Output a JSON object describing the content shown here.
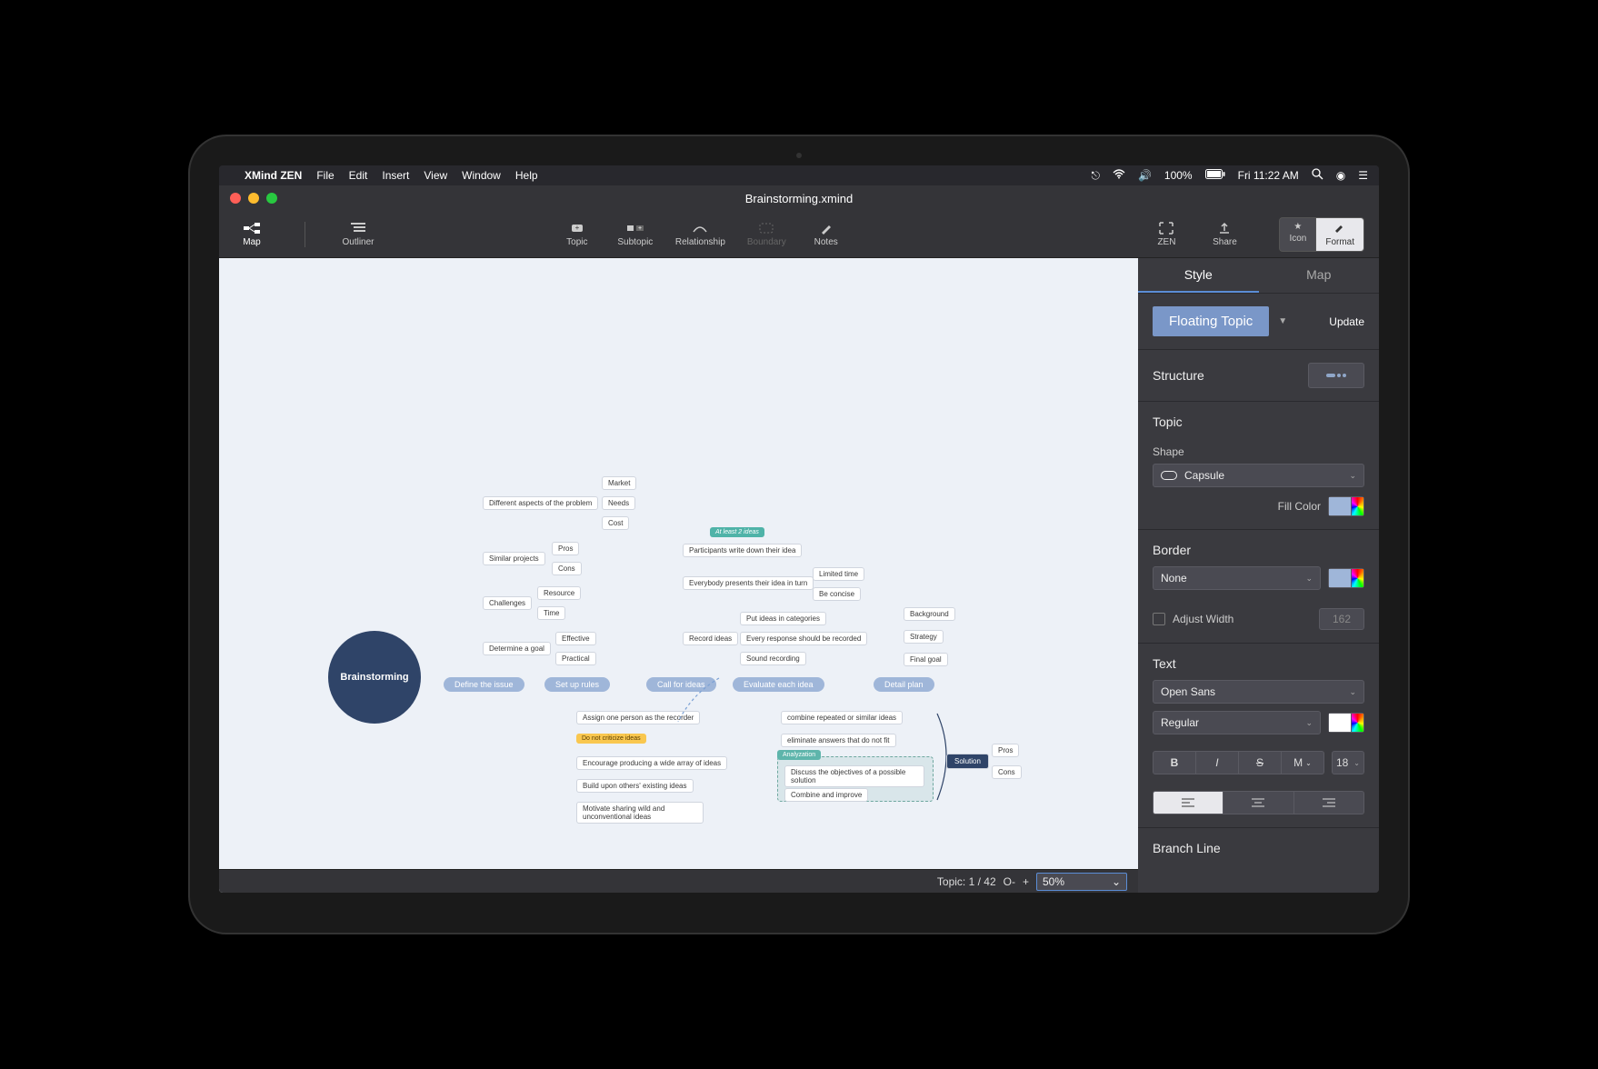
{
  "menubar": {
    "app_name": "XMind ZEN",
    "items": [
      "File",
      "Edit",
      "Insert",
      "View",
      "Window",
      "Help"
    ],
    "battery_pct": "100%",
    "clock": "Fri 11:22 AM"
  },
  "window": {
    "title": "Brainstorming.xmind"
  },
  "toolbar": {
    "map": "Map",
    "outliner": "Outliner",
    "topic": "Topic",
    "subtopic": "Subtopic",
    "relationship": "Relationship",
    "boundary": "Boundary",
    "notes": "Notes",
    "zen": "ZEN",
    "share": "Share",
    "icon": "Icon",
    "format": "Format"
  },
  "mindmap": {
    "central": "Brainstorming",
    "main_topics": [
      "Define the issue",
      "Set up rules",
      "Call for ideas",
      "Evaluate each idea",
      "Detail plan"
    ],
    "define_issue": {
      "aspects": "Different aspects of the problem",
      "aspects_children": [
        "Market",
        "Needs",
        "Cost"
      ],
      "similar": "Similar projects",
      "similar_children": [
        "Pros",
        "Cons"
      ],
      "challenges": "Challenges",
      "challenges_children": [
        "Resource",
        "Time"
      ],
      "goal": "Determine a goal",
      "goal_children": [
        "Effective",
        "Practical"
      ]
    },
    "set_up_rules": {
      "items": [
        "Assign one person as the recorder",
        "Do not criticize ideas",
        "Encourage producing a wide array of ideas",
        "Build upon others' existing ideas",
        "Motivate sharing wild and unconventional ideas"
      ]
    },
    "call_for_ideas": {
      "callout": "At least 2 ideas",
      "items": [
        "Participants write down their idea",
        "Everybody presents their idea in turn",
        "Record ideas"
      ],
      "everybody_children": [
        "Limited time",
        "Be concise"
      ],
      "record_children": [
        "Put ideas in categories",
        "Every response should be recorded",
        "Sound recording"
      ]
    },
    "evaluate": {
      "items": [
        "combine repeated or similar ideas",
        "eliminate answers that do not fit",
        "Discuss the objectives of a possible solution",
        "Combine and improve"
      ],
      "boundary_label": "Analyzation",
      "solution": "Solution",
      "solution_children": [
        "Pros",
        "Cons"
      ]
    },
    "detail_plan": {
      "items": [
        "Background",
        "Strategy",
        "Final goal"
      ]
    }
  },
  "sidebar": {
    "tabs": {
      "style": "Style",
      "map": "Map"
    },
    "preset": {
      "label": "Floating Topic",
      "update": "Update"
    },
    "structure": {
      "label": "Structure"
    },
    "topic": {
      "heading": "Topic",
      "shape_label": "Shape",
      "shape_value": "Capsule",
      "fill_label": "Fill Color",
      "fill_color": "#9fb6d9"
    },
    "border": {
      "heading": "Border",
      "value": "None",
      "color": "#9fb6d9",
      "adjust_label": "Adjust Width",
      "width_value": "162"
    },
    "text": {
      "heading": "Text",
      "font": "Open Sans",
      "weight": "Regular",
      "color": "#ffffff",
      "bold": "B",
      "italic": "I",
      "strike": "S",
      "m": "M",
      "size": "18"
    },
    "branch": {
      "heading": "Branch Line"
    }
  },
  "statusbar": {
    "topic_label": "Topic: 1 / 42",
    "zoom_out": "O-",
    "zoom_in": "+",
    "zoom_value": "50%"
  }
}
